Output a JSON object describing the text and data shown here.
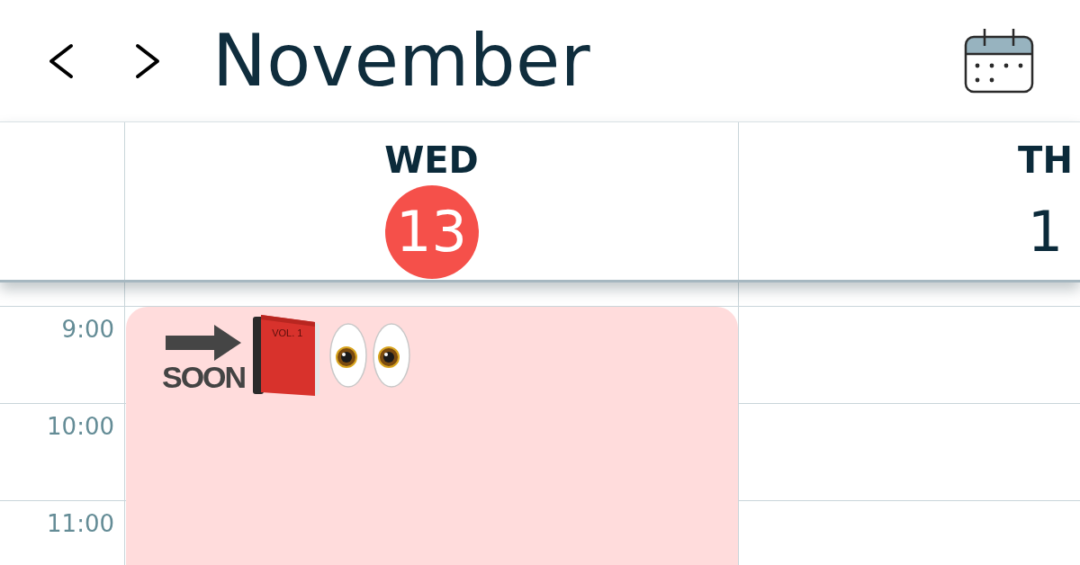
{
  "toolbar": {
    "nav_buttons": [
      {
        "kind": "previous"
      },
      {
        "kind": "next"
      }
    ],
    "title": "November",
    "actions": [
      {
        "kind": "calendar"
      }
    ]
  },
  "days": [
    {
      "weekday": "WED",
      "date": "13",
      "today": true,
      "events": [
        {
          "symbols": [
            {
              "kind": "arrow",
              "label": "SOON"
            },
            {
              "kind": "book",
              "label": "VOL. 1"
            },
            {
              "kind": "eyes"
            }
          ]
        }
      ]
    },
    {
      "weekday": "TH",
      "date": "1",
      "today": false
    }
  ],
  "time_slots": [
    "9:00",
    "10:00",
    "11:00"
  ]
}
